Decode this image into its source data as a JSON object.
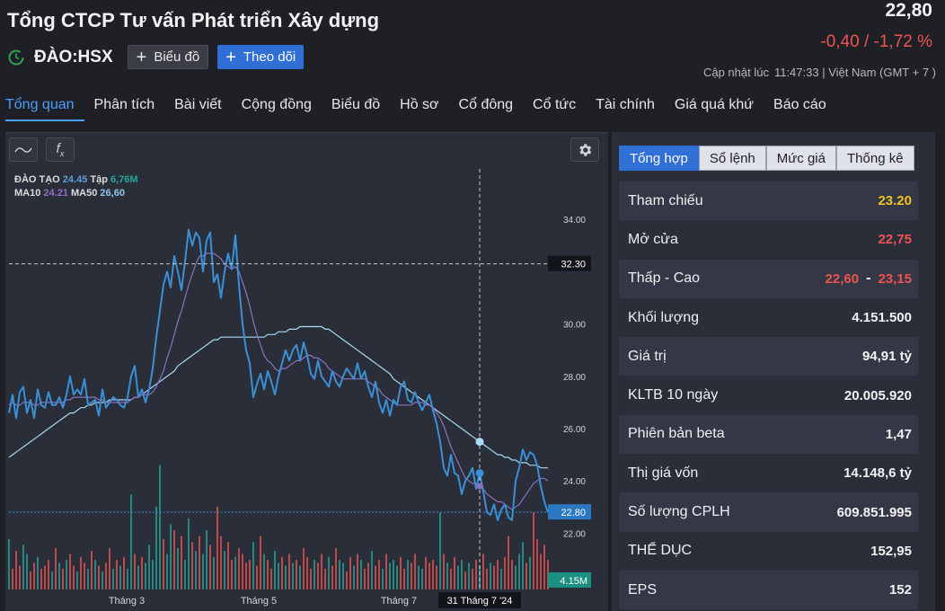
{
  "header": {
    "company_name": "Tổng CTCP Tư vấn Phát triển Xây dựng",
    "ticker": "ĐÀO:HSX",
    "chart_button_label": "Biểu đồ",
    "follow_button_label": "Theo dõi",
    "price": "22,80",
    "change": "-0,40 / -1,72 %",
    "updated_label": "Cập nhật lúc",
    "updated_time": "11:47:33 | Việt Nam (GMT + 7 )"
  },
  "nav": {
    "items": [
      "Tổng quan",
      "Phân tích",
      "Bài viết",
      "Cộng đồng",
      "Biểu đồ",
      "Hồ sơ",
      "Cổ đông",
      "Cổ tức",
      "Tài chính",
      "Giá quá khứ",
      "Báo cáo"
    ],
    "active": "Tổng quan"
  },
  "chart_toolbar": {
    "indicator_icon": "wave-icon",
    "function_label": "f",
    "function_sub": "x",
    "settings_icon": "gear-icon"
  },
  "legend": {
    "ticker": "ĐÀO TẠO",
    "price": "24.45",
    "vol_label": "Tập",
    "vol": "6,76M",
    "ma10_label": "MA10",
    "ma10": "24.21",
    "ma50_label": "MA50",
    "ma50": "26,60"
  },
  "chart_data": {
    "type": "line",
    "y_ticks": [
      "34.00",
      "30.00",
      "28.00",
      "26.00",
      "24.00",
      "22.00"
    ],
    "ylim": [
      21.5,
      34.9
    ],
    "x_labels": [
      "Tháng 3",
      "Tháng 5",
      "Tháng 7"
    ],
    "crosshair_x_label": "31 Tháng 7 '24",
    "crosshair_y_label": "32.30",
    "last_price_label": "22.80",
    "last_volume_label": "4.15M",
    "colors": {
      "price": "#3b8fd4",
      "ma10": "#8e6fc3",
      "ma50": "#a9dcf5",
      "vol_up": "#26a69a",
      "vol_down": "#ef5350"
    },
    "series": [
      {
        "name": "ĐÀO TẠO",
        "values": [
          26.6,
          27.3,
          26.4,
          27.4,
          27.6,
          26.6,
          27.1,
          26.4,
          27.5,
          26.9,
          26.8,
          27.4,
          26.9,
          26.9,
          27.2,
          26.8,
          27.3,
          28.0,
          27.3,
          27.5,
          27.3,
          27.9,
          26.9,
          27.0,
          27.1,
          26.5,
          27.5,
          26.8,
          27.0,
          27.2,
          27.1,
          26.9,
          26.8,
          27.2,
          28.0,
          28.4,
          27.2,
          27.5,
          27.0,
          27.5,
          28.3,
          29.5,
          30.5,
          31.5,
          32.0,
          31.4,
          32.6,
          32.0,
          31.3,
          32.4,
          33.6,
          33.0,
          33.5,
          33.3,
          32.0,
          33.2,
          33.5,
          31.6,
          31.9,
          31.0,
          32.0,
          32.7,
          32.1,
          33.4,
          31.5,
          30.0,
          29.0,
          28.5,
          27.2,
          27.7,
          28.1,
          27.5,
          28.2,
          27.8,
          27.3,
          28.0,
          28.5,
          29.0,
          28.6,
          29.0,
          29.2,
          28.6,
          29.3,
          28.8,
          28.1,
          27.9,
          28.6,
          28.0,
          27.8,
          27.6,
          28.2,
          27.8,
          27.6,
          28.0,
          28.3,
          28.1,
          27.9,
          28.5,
          27.9,
          28.2,
          27.6,
          27.2,
          27.8,
          27.0,
          26.6,
          27.1,
          26.5,
          27.1,
          26.9,
          27.6,
          27.8,
          27.1,
          27.0,
          27.4,
          27.0,
          26.7,
          27.0,
          27.3,
          26.7,
          26.2,
          25.5,
          24.5,
          24.2,
          25.0,
          24.3,
          24.2,
          23.5,
          24.0,
          24.2,
          24.5,
          23.7,
          24.3,
          23.6,
          22.8,
          22.7,
          23.1,
          22.5,
          22.9,
          23.1,
          22.6,
          22.5,
          24.0,
          24.5,
          25.2,
          24.8,
          25.1,
          25.0,
          24.6,
          23.8,
          23.2,
          22.8
        ]
      },
      {
        "name": "MA10",
        "values": [
          26.9,
          27.0,
          26.9,
          26.9,
          27.0,
          27.0,
          27.0,
          26.9,
          26.9,
          27.0,
          27.0,
          27.0,
          27.0,
          27.0,
          27.0,
          27.0,
          27.1,
          27.1,
          27.2,
          27.2,
          27.2,
          27.2,
          27.2,
          27.2,
          27.2,
          27.1,
          27.1,
          27.0,
          27.0,
          27.0,
          27.0,
          27.0,
          27.0,
          27.0,
          27.1,
          27.2,
          27.2,
          27.3,
          27.3,
          27.3,
          27.4,
          27.6,
          27.9,
          28.2,
          28.7,
          29.1,
          29.6,
          30.1,
          30.5,
          31.0,
          31.5,
          31.9,
          32.3,
          32.6,
          32.6,
          32.7,
          32.7,
          32.7,
          32.6,
          32.5,
          32.3,
          32.2,
          32.1,
          32.2,
          32.0,
          31.6,
          31.2,
          30.7,
          30.1,
          29.6,
          29.2,
          28.8,
          28.6,
          28.5,
          28.3,
          28.2,
          28.3,
          28.3,
          28.4,
          28.5,
          28.6,
          28.6,
          28.7,
          28.8,
          28.8,
          28.7,
          28.7,
          28.6,
          28.5,
          28.3,
          28.2,
          28.1,
          28.0,
          27.9,
          27.9,
          27.9,
          27.9,
          27.9,
          27.9,
          27.9,
          27.8,
          27.7,
          27.6,
          27.5,
          27.3,
          27.2,
          27.1,
          27.0,
          26.9,
          26.9,
          26.9,
          26.9,
          26.9,
          27.0,
          27.0,
          27.0,
          26.9,
          26.9,
          26.8,
          26.6,
          26.4,
          26.1,
          25.7,
          25.3,
          25.0,
          24.7,
          24.4,
          24.1,
          24.0,
          23.9,
          23.9,
          23.8,
          23.7,
          23.5,
          23.4,
          23.3,
          23.2,
          23.2,
          23.1,
          23.0,
          22.9,
          23.0,
          23.1,
          23.3,
          23.5,
          23.7,
          23.9,
          24.0,
          24.1,
          24.1,
          24.0
        ]
      },
      {
        "name": "MA50",
        "values": [
          24.9,
          25.0,
          25.1,
          25.2,
          25.3,
          25.4,
          25.5,
          25.6,
          25.7,
          25.8,
          25.9,
          26.0,
          26.1,
          26.2,
          26.3,
          26.4,
          26.5,
          26.6,
          26.6,
          26.7,
          26.8,
          26.8,
          26.9,
          26.9,
          27.0,
          27.0,
          27.0,
          27.0,
          27.1,
          27.1,
          27.1,
          27.1,
          27.1,
          27.1,
          27.1,
          27.2,
          27.2,
          27.3,
          27.4,
          27.5,
          27.6,
          27.7,
          27.8,
          27.9,
          28.0,
          28.1,
          28.2,
          28.4,
          28.5,
          28.6,
          28.7,
          28.8,
          28.9,
          29.0,
          29.1,
          29.2,
          29.3,
          29.4,
          29.4,
          29.5,
          29.5,
          29.5,
          29.5,
          29.5,
          29.5,
          29.5,
          29.5,
          29.5,
          29.5,
          29.5,
          29.5,
          29.5,
          29.6,
          29.6,
          29.6,
          29.7,
          29.7,
          29.7,
          29.8,
          29.8,
          29.8,
          29.9,
          29.9,
          29.9,
          29.9,
          29.9,
          29.9,
          29.9,
          29.8,
          29.8,
          29.7,
          29.6,
          29.5,
          29.4,
          29.3,
          29.2,
          29.1,
          29.0,
          28.9,
          28.8,
          28.7,
          28.6,
          28.5,
          28.4,
          28.3,
          28.2,
          28.1,
          27.9,
          27.8,
          27.7,
          27.6,
          27.5,
          27.4,
          27.3,
          27.2,
          27.1,
          27.0,
          26.9,
          26.8,
          26.7,
          26.6,
          26.5,
          26.4,
          26.3,
          26.2,
          26.1,
          26.0,
          25.9,
          25.8,
          25.7,
          25.6,
          25.5,
          25.4,
          25.3,
          25.2,
          25.1,
          25.0,
          25.0,
          24.9,
          24.9,
          24.8,
          24.8,
          24.7,
          24.7,
          24.7,
          24.6,
          24.6,
          24.6,
          24.5,
          24.5,
          24.5
        ]
      },
      {
        "name": "volume",
        "values": [
          0.85,
          0.35,
          0.65,
          0.4,
          0.75,
          0.6,
          0.3,
          0.45,
          0.55,
          0.35,
          0.4,
          0.5,
          0.3,
          0.7,
          0.45,
          0.35,
          0.5,
          0.6,
          0.4,
          0.3,
          0.55,
          0.45,
          0.35,
          0.65,
          0.5,
          0.4,
          0.3,
          0.45,
          0.7,
          0.35,
          0.5,
          0.4,
          0.55,
          0.35,
          1.6,
          0.6,
          0.4,
          0.55,
          0.45,
          0.75,
          0.5,
          1.4,
          2.1,
          0.85,
          0.6,
          1.1,
          1.0,
          0.7,
          0.9,
          0.5,
          1.2,
          0.8,
          0.65,
          0.9,
          0.6,
          1.0,
          0.75,
          0.55,
          1.4,
          0.9,
          0.65,
          0.8,
          0.5,
          0.55,
          0.7,
          0.6,
          0.45,
          0.5,
          0.8,
          0.4,
          0.9,
          0.6,
          0.5,
          0.35,
          0.65,
          0.45,
          0.55,
          0.4,
          0.6,
          0.45,
          0.5,
          0.4,
          0.7,
          0.55,
          0.35,
          0.5,
          0.45,
          0.6,
          0.35,
          0.55,
          0.4,
          0.7,
          0.5,
          0.45,
          0.3,
          0.55,
          0.4,
          0.6,
          0.5,
          0.35,
          0.45,
          0.65,
          0.4,
          0.5,
          0.35,
          0.6,
          0.45,
          0.5,
          0.4,
          0.55,
          0.35,
          0.5,
          0.45,
          0.6,
          0.4,
          0.35,
          0.55,
          0.45,
          0.5,
          0.4,
          1.3,
          0.6,
          0.45,
          0.35,
          0.55,
          0.4,
          0.5,
          0.3,
          0.45,
          0.35,
          0.5,
          0.4,
          0.6,
          0.35,
          0.45,
          0.4,
          0.5,
          0.35,
          0.55,
          0.9,
          0.5,
          0.4,
          0.6,
          0.8,
          0.45,
          0.55,
          1.3,
          0.85,
          0.6,
          0.75,
          0.5
        ]
      }
    ],
    "volume_up": [
      1,
      0,
      0,
      0,
      1,
      1,
      0,
      0,
      1,
      0,
      0,
      0,
      1,
      0,
      1,
      0,
      1,
      0,
      0,
      1,
      0,
      0,
      1,
      0,
      1,
      0,
      1,
      0,
      0,
      1,
      0,
      1,
      0,
      1,
      1,
      0,
      1,
      0,
      1,
      1,
      1,
      1,
      1,
      0,
      1,
      1,
      0,
      1,
      0,
      1,
      1,
      0,
      1,
      0,
      1,
      1,
      0,
      1,
      0,
      0,
      1,
      0,
      0,
      1,
      0,
      0,
      0,
      0,
      1,
      0,
      0,
      1,
      0,
      0,
      1,
      1,
      0,
      1,
      0,
      1,
      0,
      1,
      0,
      0,
      0,
      1,
      0,
      0,
      0,
      1,
      0,
      0,
      1,
      1,
      0,
      0,
      1,
      0,
      1,
      0,
      0,
      1,
      0,
      0,
      1,
      0,
      1,
      1,
      1,
      0,
      0,
      1,
      0,
      0,
      1,
      1,
      0,
      0,
      0,
      0,
      1,
      0,
      1,
      0,
      0,
      1,
      1,
      0,
      1,
      0,
      0,
      1,
      0,
      0,
      1,
      0,
      0,
      1,
      0,
      0,
      0,
      1,
      1,
      1,
      0,
      1,
      0,
      0,
      0,
      0
    ]
  },
  "side_panel": {
    "tabs": [
      "Tổng hợp",
      "Sổ lệnh",
      "Mức giá",
      "Thống kê"
    ],
    "active_tab": "Tổng hợp",
    "rows": [
      {
        "label": "Tham chiếu",
        "value": "23.20",
        "color": "yellow"
      },
      {
        "label": "Mở cửa",
        "value": "22,75",
        "color": "red"
      },
      {
        "label": "Thấp - Cao",
        "low": "22,60",
        "sep": "-",
        "high": "23,15"
      },
      {
        "label": "Khối lượng",
        "value": "4.151.500",
        "color": "white"
      },
      {
        "label": "Giá trị",
        "value": "94,91 tỷ",
        "color": "white"
      },
      {
        "label": "KLTB 10 ngày",
        "value": "20.005.920",
        "color": "white"
      },
      {
        "label": "Phiên bản beta",
        "value": "1,47",
        "color": "white"
      },
      {
        "label": "Thị giá vốn",
        "value": "14.148,6 tỷ",
        "color": "white"
      },
      {
        "label": "Số lượng CPLH",
        "value": "609.851.995",
        "color": "white"
      },
      {
        "label": "THỂ DỤC",
        "value": "152,95",
        "color": "white"
      },
      {
        "label": "EPS",
        "value": "152",
        "color": "white"
      }
    ]
  }
}
